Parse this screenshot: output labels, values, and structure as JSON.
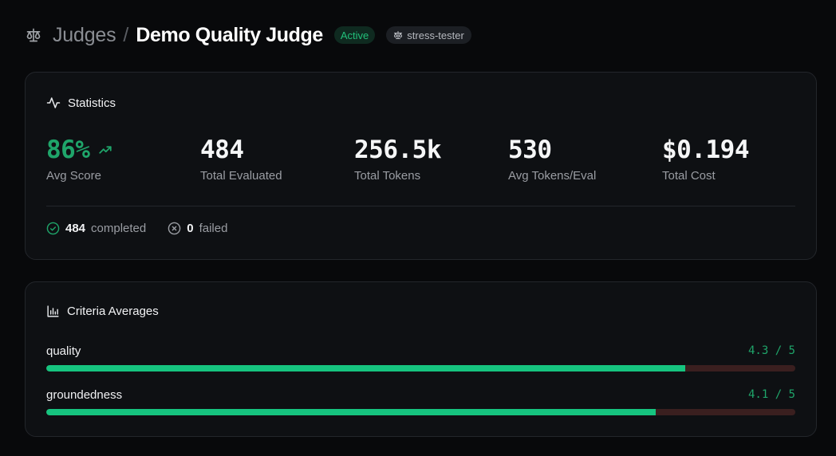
{
  "header": {
    "breadcrumb_parent": "Judges",
    "separator": "/",
    "title": "Demo Quality Judge",
    "status_badge": "Active",
    "tag_badge": "stress-tester"
  },
  "statistics": {
    "title": "Statistics",
    "avg_score": {
      "value": "86%",
      "label": "Avg Score"
    },
    "total_evaluated": {
      "value": "484",
      "label": "Total Evaluated"
    },
    "total_tokens": {
      "value": "256.5k",
      "label": "Total Tokens"
    },
    "avg_tokens": {
      "value": "530",
      "label": "Avg Tokens/Eval"
    },
    "total_cost": {
      "value": "$0.194",
      "label": "Total Cost"
    },
    "completed": {
      "count": "484",
      "label": "completed"
    },
    "failed": {
      "count": "0",
      "label": "failed"
    }
  },
  "criteria": {
    "title": "Criteria Averages",
    "items": [
      {
        "name": "quality",
        "score_text": "4.3 / 5",
        "fraction": 0.853
      },
      {
        "name": "groundedness",
        "score_text": "4.1 / 5",
        "fraction": 0.814
      }
    ]
  },
  "colors": {
    "accent_green": "#1fa56a",
    "bar_fill": "#16c47f",
    "bar_track": "#3a1f1f",
    "background": "#08090b"
  },
  "icons": {
    "header": "scale-icon",
    "statistics": "activity-icon",
    "trend": "trending-up-icon",
    "completed": "check-circle-icon",
    "failed": "x-circle-icon",
    "criteria": "bar-chart-icon"
  }
}
